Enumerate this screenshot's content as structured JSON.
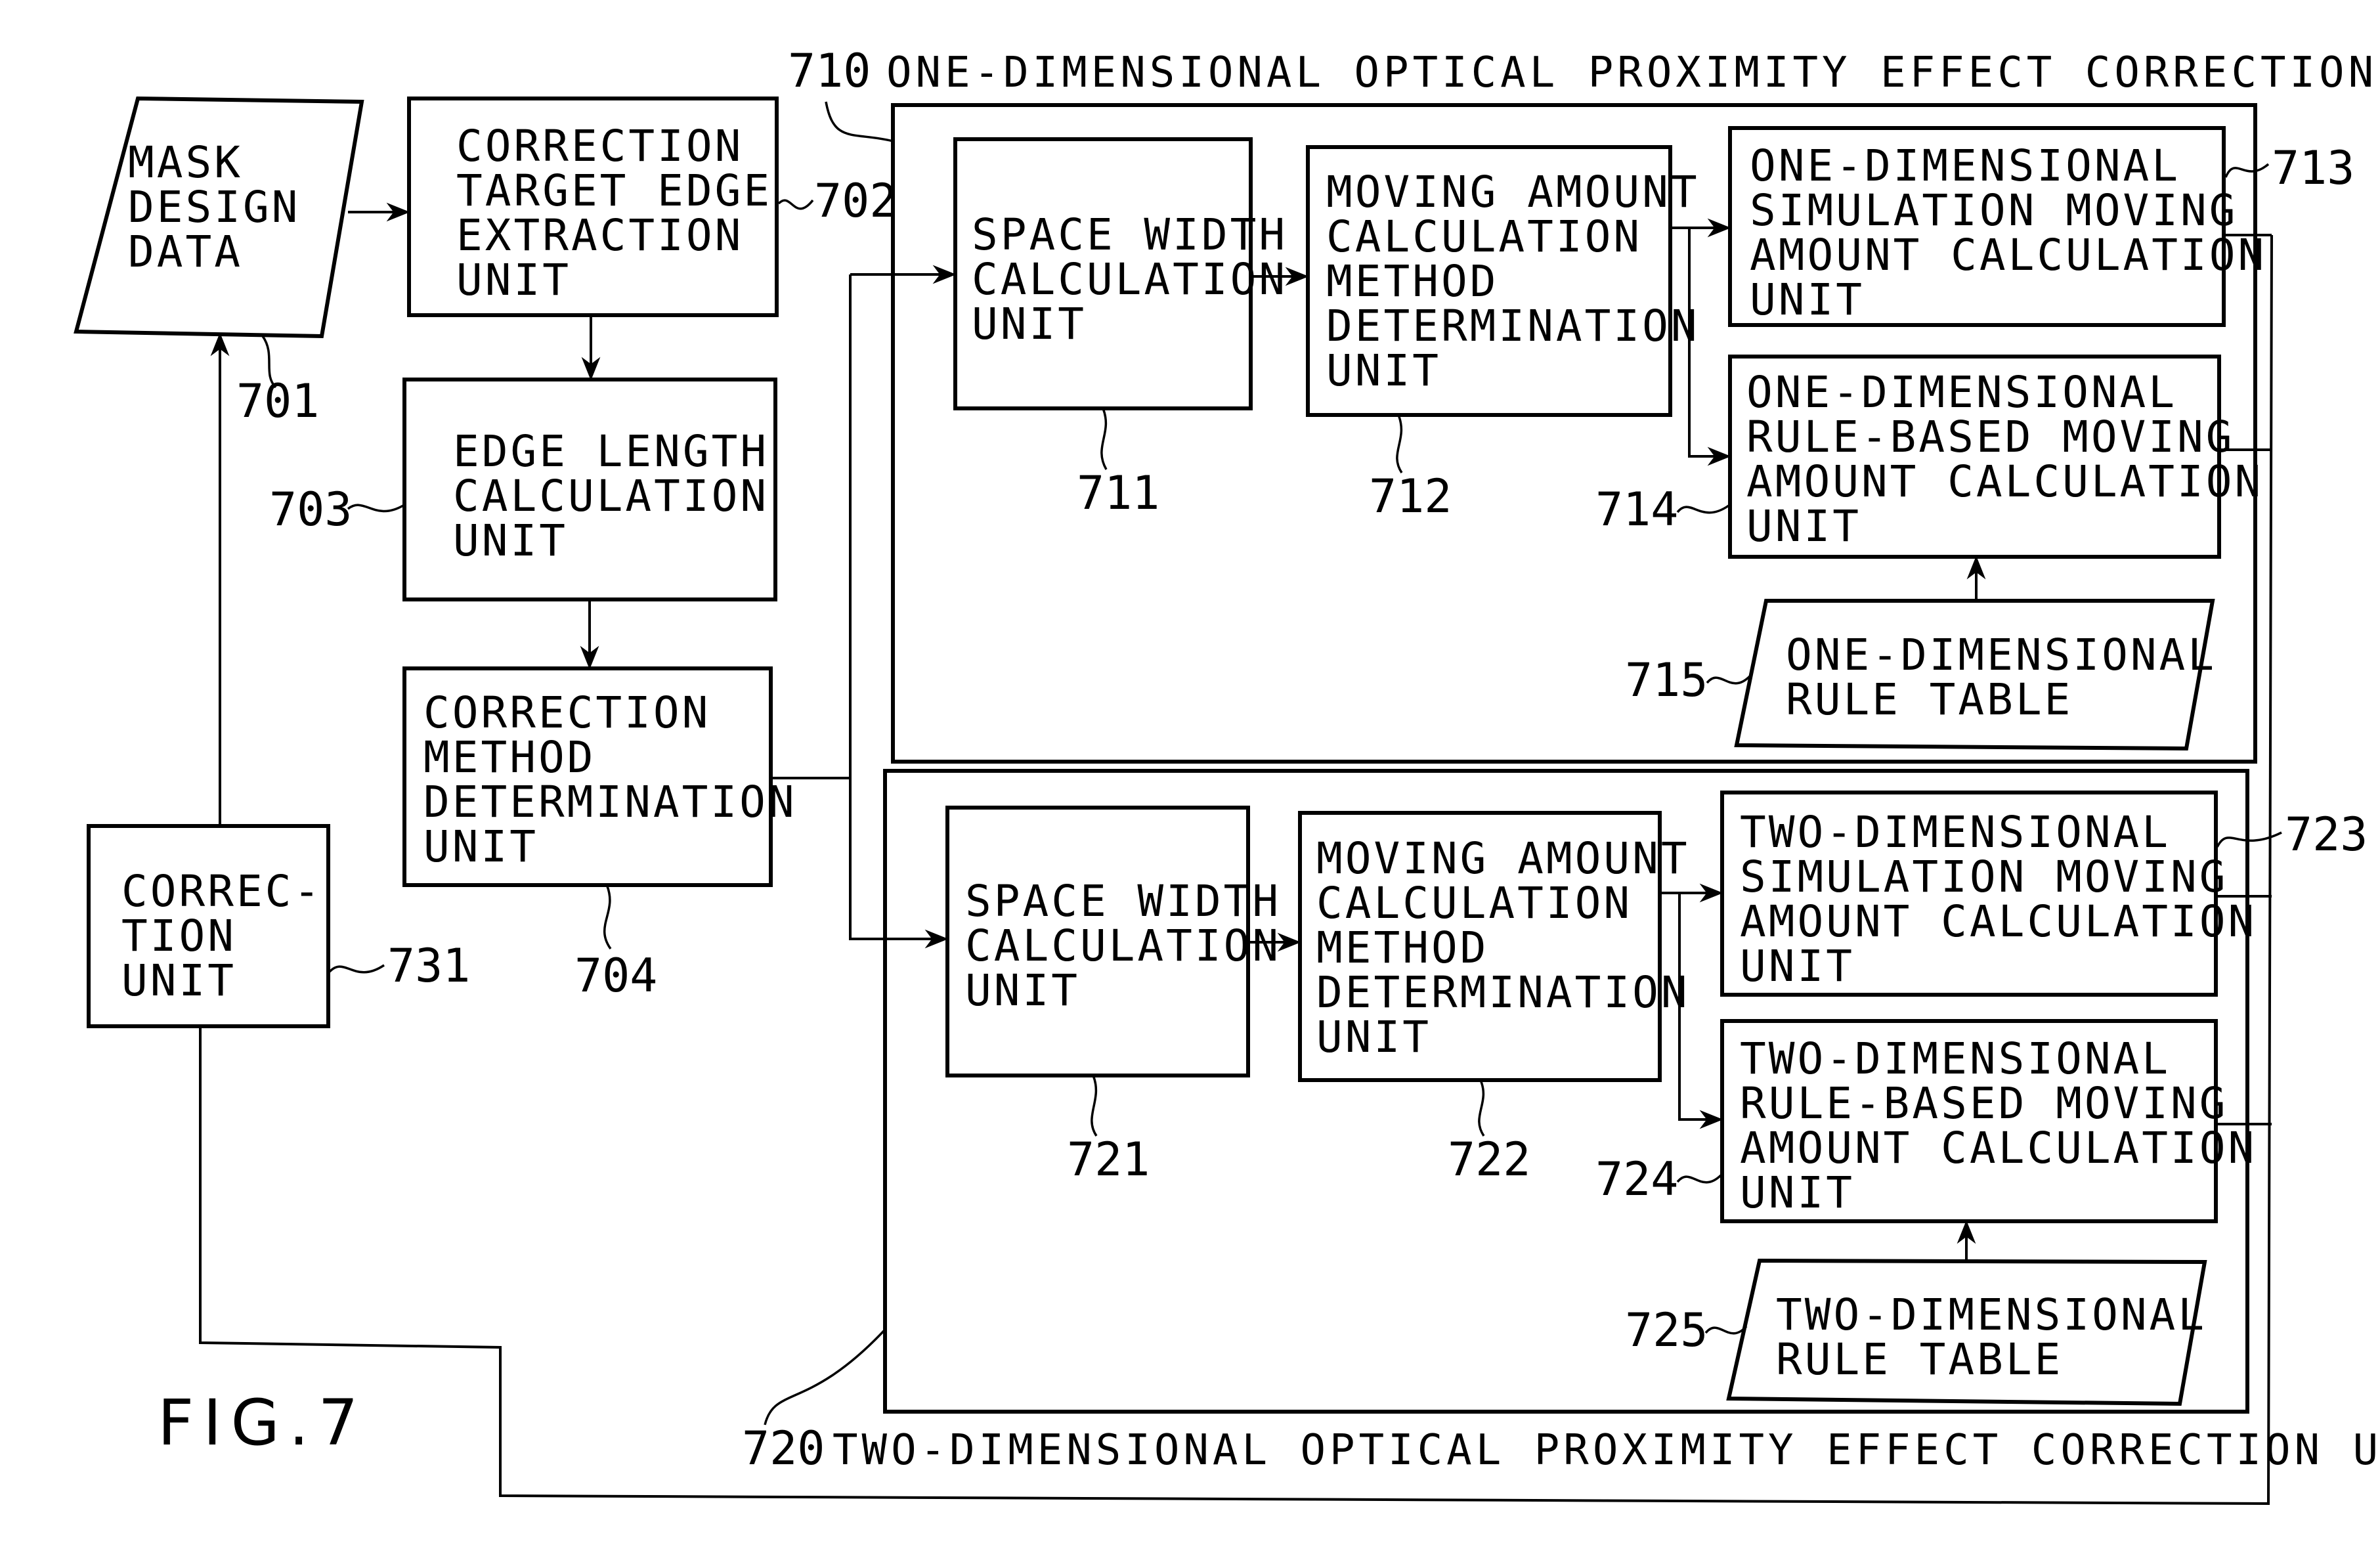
{
  "figure_label": "FIG.7",
  "groups": {
    "one_dim": {
      "ref": "710",
      "title": "ONE-DIMENSIONAL OPTICAL PROXIMITY EFFECT CORRECTION UNIT"
    },
    "two_dim": {
      "ref": "720",
      "title": "TWO-DIMENSIONAL OPTICAL PROXIMITY EFFECT CORRECTION UNIT"
    }
  },
  "blocks": {
    "mask_design_data": {
      "ref": "701",
      "lines": [
        "MASK",
        "DESIGN",
        "DATA"
      ]
    },
    "target_edge_extraction": {
      "ref": "702",
      "lines": [
        "CORRECTION",
        "TARGET EDGE",
        "EXTRACTION",
        "UNIT"
      ]
    },
    "edge_length_calc": {
      "ref": "703",
      "lines": [
        "EDGE LENGTH",
        "CALCULATION",
        "UNIT"
      ]
    },
    "correction_method_det": {
      "ref": "704",
      "lines": [
        "CORRECTION",
        "METHOD",
        "DETERMINATION",
        "UNIT"
      ]
    },
    "correction_unit": {
      "ref": "731",
      "lines": [
        "CORREC-",
        "TION",
        "UNIT"
      ]
    },
    "space_width_1d": {
      "ref": "711",
      "lines": [
        "SPACE WIDTH",
        "CALCULATION",
        "UNIT"
      ]
    },
    "moving_method_1d": {
      "ref": "712",
      "lines": [
        "MOVING AMOUNT",
        "CALCULATION",
        "METHOD",
        "DETERMINATION",
        "UNIT"
      ]
    },
    "sim_moving_1d": {
      "ref": "713",
      "lines": [
        "ONE-DIMENSIONAL",
        "SIMULATION MOVING",
        "AMOUNT CALCULATION",
        "UNIT"
      ]
    },
    "rule_moving_1d": {
      "ref": "714",
      "lines": [
        "ONE-DIMENSIONAL",
        "RULE-BASED MOVING",
        "AMOUNT CALCULATION",
        "UNIT"
      ]
    },
    "rule_table_1d": {
      "ref": "715",
      "lines": [
        "ONE-DIMENSIONAL",
        "RULE TABLE"
      ]
    },
    "space_width_2d": {
      "ref": "721",
      "lines": [
        "SPACE WIDTH",
        "CALCULATION",
        "UNIT"
      ]
    },
    "moving_method_2d": {
      "ref": "722",
      "lines": [
        "MOVING AMOUNT",
        "CALCULATION",
        "METHOD",
        "DETERMINATION",
        "UNIT"
      ]
    },
    "sim_moving_2d": {
      "ref": "723",
      "lines": [
        "TWO-DIMENSIONAL",
        "SIMULATION MOVING",
        "AMOUNT CALCULATION",
        "UNIT"
      ]
    },
    "rule_moving_2d": {
      "ref": "724",
      "lines": [
        "TWO-DIMENSIONAL",
        "RULE-BASED MOVING",
        "AMOUNT CALCULATION",
        "UNIT"
      ]
    },
    "rule_table_2d": {
      "ref": "725",
      "lines": [
        "TWO-DIMENSIONAL",
        "RULE TABLE"
      ]
    }
  }
}
